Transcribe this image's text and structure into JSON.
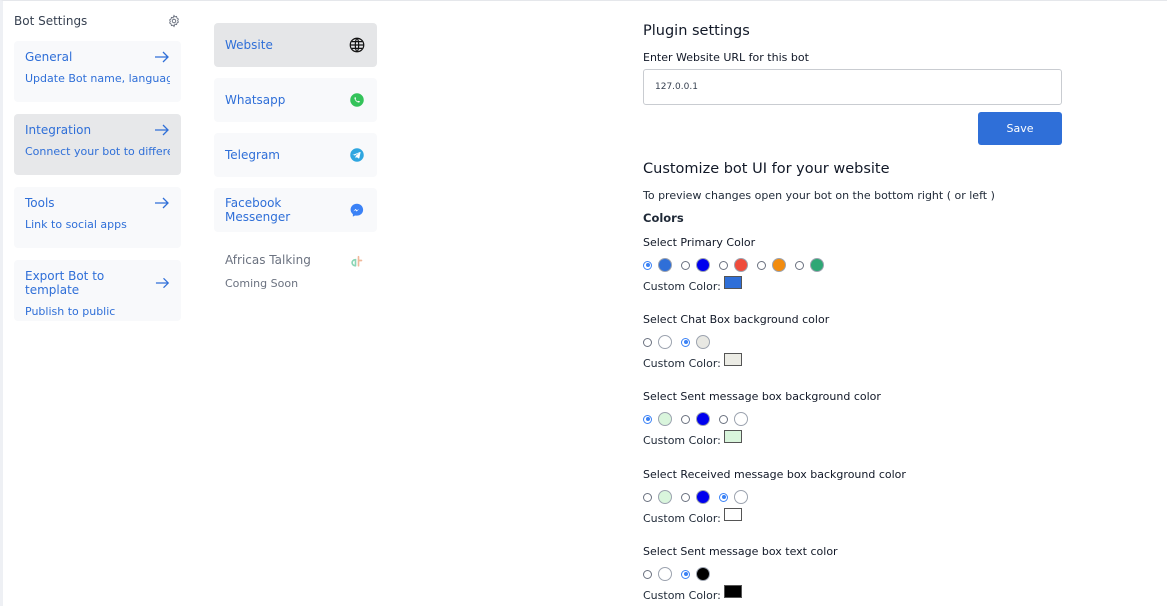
{
  "sidebar": {
    "title": "Bot Settings",
    "items": [
      {
        "title": "General",
        "subtitle": "Update Bot name, language, e"
      },
      {
        "title": "Integration",
        "subtitle": "Connect your bot to different"
      },
      {
        "title": "Tools",
        "subtitle": "Link to social apps"
      },
      {
        "title": "Export Bot to template",
        "subtitle": "Publish to public"
      }
    ]
  },
  "integrations": {
    "items": [
      {
        "label": "Website",
        "icon": "globe-icon"
      },
      {
        "label": "Whatsapp",
        "icon": "whatsapp-icon"
      },
      {
        "label": "Telegram",
        "icon": "telegram-icon"
      },
      {
        "label": "Facebook Messenger",
        "icon": "messenger-icon"
      },
      {
        "label": "Africas Talking",
        "subtitle": "Coming Soon",
        "icon": "africas-talking-icon"
      }
    ]
  },
  "plugin": {
    "heading": "Plugin settings",
    "url_label": "Enter Website URL for this bot",
    "url_value": "127.0.0.1",
    "save_label": "Save"
  },
  "customize": {
    "heading": "Customize bot UI for your website",
    "hint": "To preview changes open your bot on the bottom right ( or left )",
    "colors_heading": "Colors",
    "custom_label": "Custom Color:",
    "groups": [
      {
        "label": "Select Primary Color",
        "options": [
          "#2f6fd8",
          "#0000ee",
          "#ef4c3c",
          "#f28c0f",
          "#2ea775"
        ],
        "selected": 0,
        "custom": "#2f6fd8"
      },
      {
        "label": "Select Chat Box background color",
        "options": [
          "#ffffff",
          "#e8e8e3"
        ],
        "selected": 1,
        "custom": "#ecece5"
      },
      {
        "label": "Select Sent message box background color",
        "options": [
          "#d9f5dc",
          "#0000ee",
          "#ffffff"
        ],
        "selected": 0,
        "custom": "#d9f5dc"
      },
      {
        "label": "Select Received message box background color",
        "options": [
          "#d9f5dc",
          "#0000ee",
          "#ffffff"
        ],
        "selected": 2,
        "custom": "#ffffff"
      },
      {
        "label": "Select Sent message box text color",
        "options": [
          "#ffffff",
          "#000000"
        ],
        "selected": 1,
        "custom": "#000000"
      }
    ]
  }
}
